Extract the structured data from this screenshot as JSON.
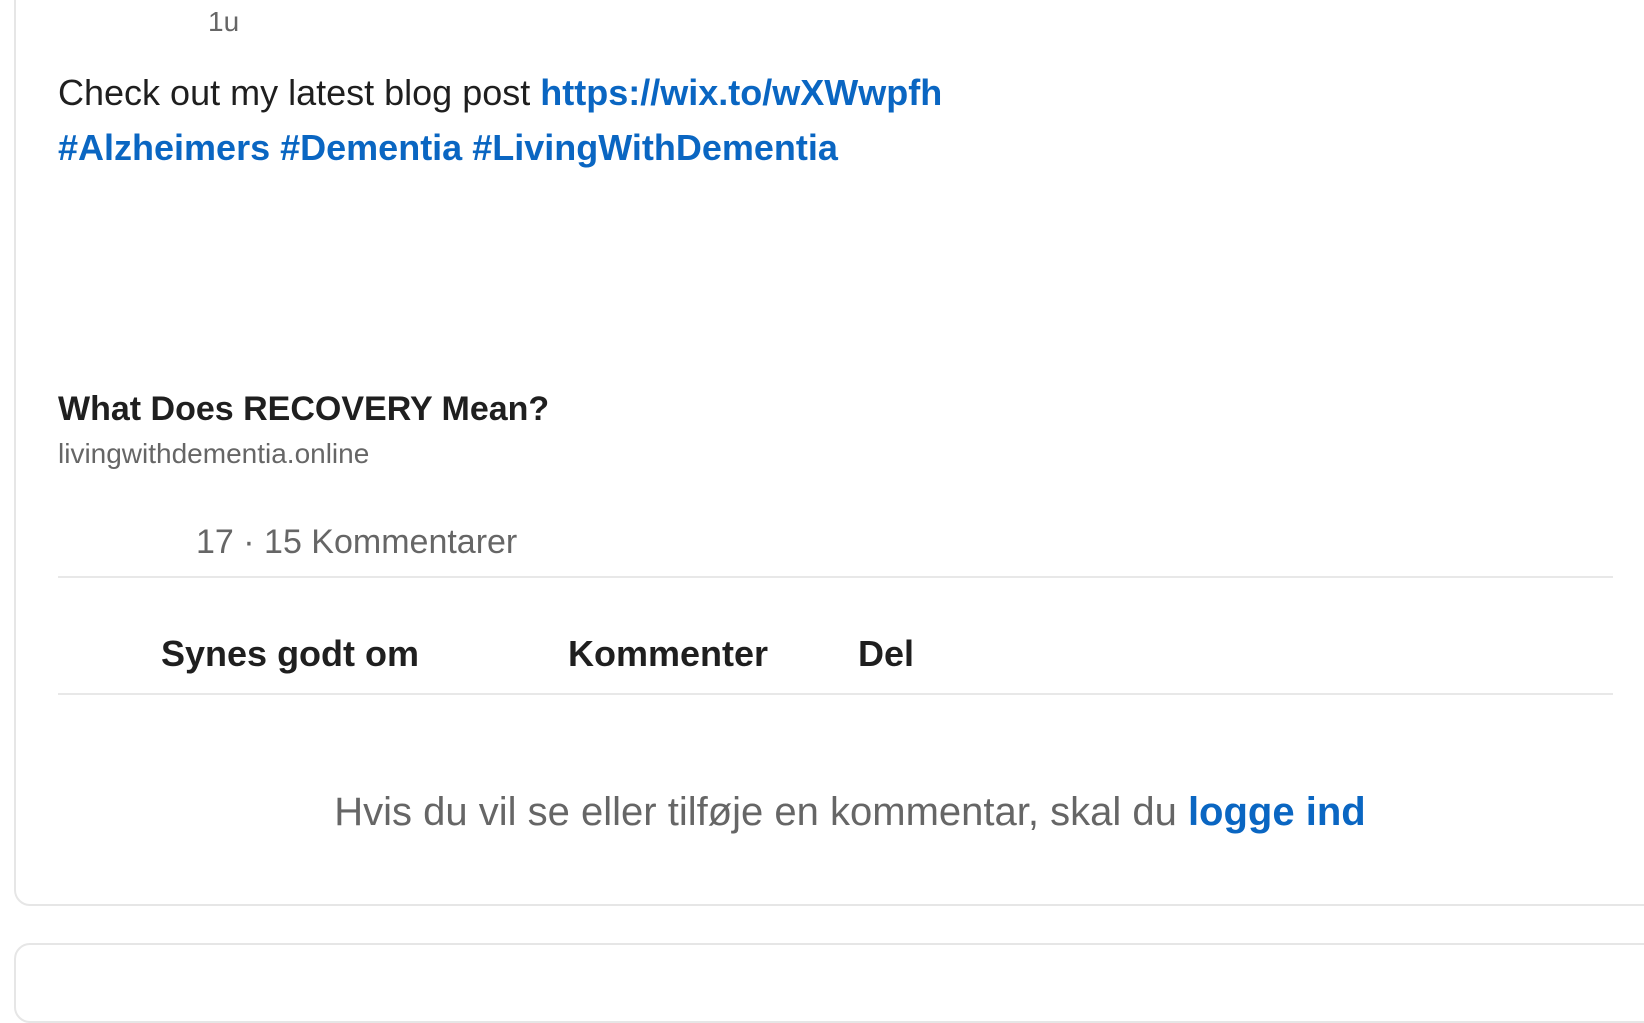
{
  "post": {
    "time": "1u",
    "text": "Check out my latest blog post ",
    "url": "https://wix.to/wXWwpfh",
    "hashtags": [
      "#Alzheimers",
      "#Dementia",
      "#LivingWithDementia"
    ]
  },
  "preview": {
    "title": "What Does RECOVERY Mean?",
    "domain": "livingwithdementia.online"
  },
  "stats": {
    "counts": "17 · 15 Kommentarer"
  },
  "actions": {
    "like": "Synes godt om",
    "comment": "Kommenter",
    "share": "Del"
  },
  "signin": {
    "prompt": "Hvis du vil se eller tilføje en kommentar, skal du ",
    "link": "logge ind"
  },
  "colors": {
    "link": "#0a66c2",
    "muted": "#666666",
    "text": "#1f1f1f",
    "border": "#e6e6e6"
  }
}
